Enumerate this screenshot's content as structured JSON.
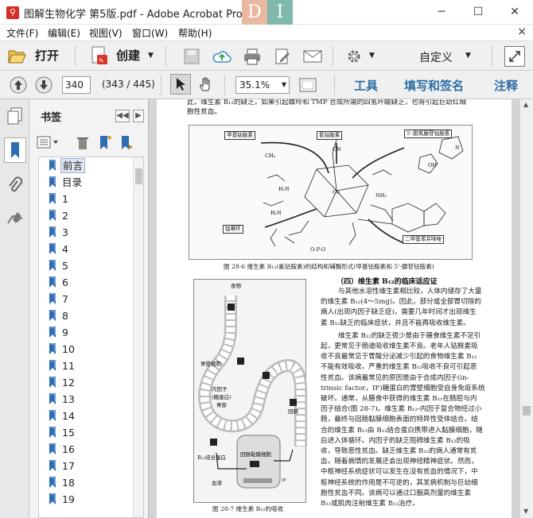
{
  "window": {
    "title": "图解生物化学 第5版.pdf - Adobe Acrobat Pro",
    "app_icon": "acrobat-icon",
    "brand_letters": [
      "D",
      "I"
    ],
    "minimize": "─",
    "maximize": "☐",
    "close": "✕"
  },
  "menu": {
    "items": [
      "文件(F)",
      "编辑(E)",
      "视图(V)",
      "窗口(W)",
      "帮助(H)"
    ],
    "close_glyph": "×"
  },
  "toolbar": {
    "open_label": "打开",
    "create_label": "创建",
    "customize_label": "自定义"
  },
  "navbar": {
    "page_value": "340",
    "page_count": "(343 / 445)",
    "zoom_value": "35.1%",
    "tools_label": "工具",
    "fill_sign_label": "填写和签名",
    "comment_label": "注释"
  },
  "bookmarks": {
    "title": "书签",
    "items": [
      "前言",
      "目录",
      "1",
      "2",
      "3",
      "4",
      "5",
      "6",
      "7",
      "8",
      "9",
      "10",
      "11",
      "12",
      "13",
      "14",
      "15",
      "16",
      "17",
      "18",
      "19"
    ]
  },
  "document": {
    "top_line1": "此，维生素 B₁₂的缺乏，如果引起蝶呤和 TMP 合成所需的四氢叶酸缺乏，也将引起巨幼红细",
    "top_line2": "胞性贫血。",
    "fig1_labels": {
      "methyl": "甲基钴胺素",
      "cyano": "氰钴胺素",
      "adenosyl": "5'-脱氧腺苷钴胺素",
      "ring": "钴啉环",
      "dmb": "二甲基苯并咪唑",
      "cn": "CN",
      "co": "Co",
      "ch3": "CH₃"
    },
    "fig1_caption": "图 28-6   维生素 B₁₂(氰钴胺素)的结构和辅酶形式(甲基钴胺素和 5'-腺苷钴胺素)",
    "fig2_labels": {
      "food": "食物",
      "parietal": "胃壁细胞",
      "if": "内因子\n(糖蛋白)",
      "stomach": "胃部",
      "ileum": "回肠",
      "ileal_cell": "回肠黏膜细胞",
      "b12_binding": "B₁₂结合蛋白",
      "blood": "血液",
      "b12": "B₁₂",
      "if_short": "IF"
    },
    "fig2_caption": "图 28-7   维生素 B₁₂的吸收",
    "section_heading": "（四）维生素 B₁₂的临床适应证",
    "body_lines": [
      "与其他水溶性维生素相比较，人体内储存了大量",
      "的维生素 B₁₂(4～5mg)。因此，部分或全部胃切除的",
      "病人(出现内因子缺乏症)，需要几年时间才出现维生",
      "素 B₁₂缺乏的临床症状，并且不能再吸收维生素。",
      "维生素 B₁₂的缺乏很少是由于膳食维生素不足引",
      "起，更常见于肠道吸收维生素不良。老年人钴胺素吸",
      "收不良最常见于胃酸分泌减少引起的食物维生素 B₁₂",
      "不能有效吸收。严重的维生素 B₁₂吸收不良可引起恶",
      "性贫血。该病最常见的原因是由于合成内因子(in-",
      "trinsic factor，IF)糖蛋白的胃壁细胞受自身免疫系统",
      "破坏。通常，从膳食中获得的维生素 B₁₂在肠腔与内",
      "因子结合(图 28-7)。维生素 B₁₂-内因子复合物经过小",
      "肠，最终与回肠黏膜细胞表面的特异性受体结合。结",
      "合的维生素 B₁₂由 B₁₂结合蛋白携带进入黏膜细胞，随",
      "后进入体循环。内因子的缺乏阻碍维生素 B₁₂的吸",
      "收，导致恶性贫血。缺乏维生素 B₁₂的病人通常有贫",
      "血，随着病情的发展还会出现神经精神症状。然而，",
      "中枢神经系统症状可以发生在没有贫血的情况下，中",
      "枢神经系统的作用是不可逆的，其发病机制与巨幼细",
      "胞性贫血不同。该病可以通过口服高剂量的维生素",
      "B₁₂或肌肉注射维生素 B₁₂治疗。"
    ]
  }
}
